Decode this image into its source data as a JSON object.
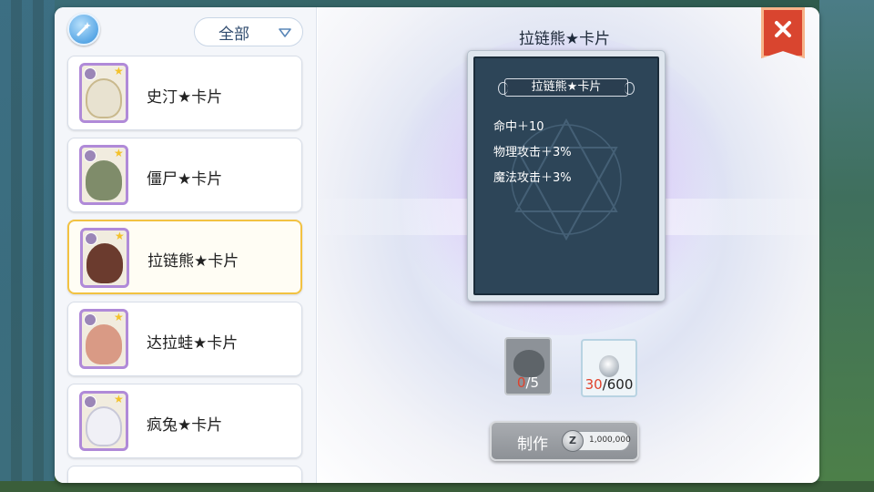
{
  "filter": {
    "selected": "全部"
  },
  "card_list": [
    {
      "name": "史汀★卡片",
      "selected": false,
      "thumb_color": "#c9b98d"
    },
    {
      "name": "僵尸★卡片",
      "selected": false,
      "thumb_color": "#7f8c6a"
    },
    {
      "name": "拉链熊★卡片",
      "selected": true,
      "thumb_color": "#6b3b2e"
    },
    {
      "name": "达拉蛙★卡片",
      "selected": false,
      "thumb_color": "#d99a85"
    },
    {
      "name": "疯兔★卡片",
      "selected": false,
      "thumb_color": "#f0f0f6"
    }
  ],
  "detail": {
    "title": "拉链熊★卡片",
    "card_banner": "拉链熊★卡片",
    "stats": [
      "命中＋10",
      "物理攻击＋3%",
      "魔法攻击＋3%"
    ]
  },
  "materials": [
    {
      "icon": "card-material-icon",
      "have": "0",
      "need": "/5"
    },
    {
      "icon": "silver-orb-icon",
      "have": "30",
      "need": "/600"
    }
  ],
  "craft": {
    "label": "制作",
    "cost": "1,000,000",
    "coin_symbol": "Z"
  },
  "colors": {
    "selected_border": "#f2c242",
    "close_red": "#d9452f",
    "shortage_red": "#e0412b"
  }
}
